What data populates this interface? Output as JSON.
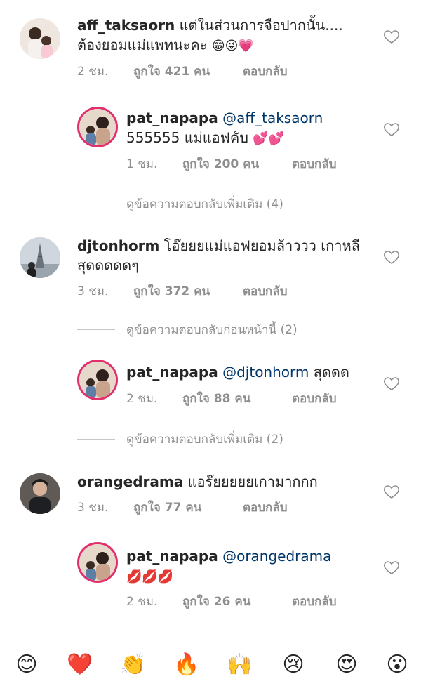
{
  "comments": [
    {
      "username": "aff_taksaorn",
      "text": "แต่ในส่วนการจือปากนั้น.... ต้องยอมแม่แพทนะคะ",
      "emoji": "😁😜💗",
      "time": "2 ชม.",
      "likes": "ถูกใจ 421 คน",
      "reply": "ตอบกลับ"
    },
    {
      "username": "pat_napapa",
      "mention": "@aff_taksaorn",
      "text": "555555 แม่แอฟคับ",
      "emoji": "💕💕",
      "time": "1 ชม.",
      "likes": "ถูกใจ 200 คน",
      "reply": "ตอบกลับ"
    },
    {
      "username": "djtonhorm",
      "text": "โอ๊ยยยแม่แอฟยอมล้าววว เกาหลีสุดดดดดๆ",
      "time": "3 ชม.",
      "likes": "ถูกใจ 372 คน",
      "reply": "ตอบกลับ"
    },
    {
      "username": "pat_napapa",
      "mention": "@djtonhorm",
      "text": "สุดดด",
      "time": "2 ชม.",
      "likes": "ถูกใจ 88 คน",
      "reply": "ตอบกลับ"
    },
    {
      "username": "orangedrama",
      "text": "แอร๊ยยยยยเกามากกก",
      "time": "3 ชม.",
      "likes": "ถูกใจ 77 คน",
      "reply": "ตอบกลับ"
    },
    {
      "username": "pat_napapa",
      "mention": "@orangedrama",
      "emoji": "💋💋💋",
      "time": "2 ชม.",
      "likes": "ถูกใจ 26 คน",
      "reply": "ตอบกลับ"
    }
  ],
  "view_more": {
    "first": "ดูข้อความตอบกลับเพิ่มเติม (4)",
    "previous": "ดูข้อความตอบกลับก่อนหน้านี้ (2)",
    "second": "ดูข้อความตอบกลับเพิ่มเติม (2)"
  },
  "emoji_bar": [
    "😊",
    "❤️",
    "👏",
    "🔥",
    "🙌",
    "😢",
    "😍",
    "😮"
  ],
  "icons": {
    "heart": "heart-outline-icon"
  },
  "colors": {
    "text": "#262626",
    "secondary": "#8e8e8e",
    "mention": "#003569",
    "story_ring": "#e1306c"
  }
}
